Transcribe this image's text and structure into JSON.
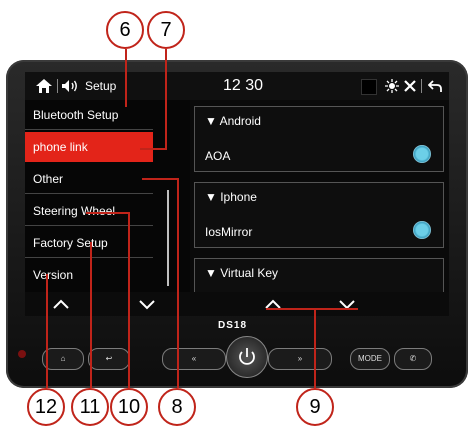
{
  "callouts": [
    "6",
    "7",
    "8",
    "9",
    "10",
    "11",
    "12"
  ],
  "status": {
    "time": "12 30",
    "setup_label": "Setup"
  },
  "menu": [
    "Bluetooth Setup",
    "phone link",
    "Other",
    "Steering Wheel",
    "Factory Setup",
    "Version"
  ],
  "cards": [
    {
      "head": "Android",
      "option": "AOA"
    },
    {
      "head": "Iphone",
      "option": "IosMirror"
    },
    {
      "head": "Virtual Key"
    }
  ],
  "brand": "DS18",
  "hardware": {
    "mode": "MODE",
    "back_label": "«",
    "forward_label": "»"
  },
  "colors": {
    "accent": "#e32419",
    "toggle": "#6ccfe8",
    "callout": "#c0241a"
  }
}
